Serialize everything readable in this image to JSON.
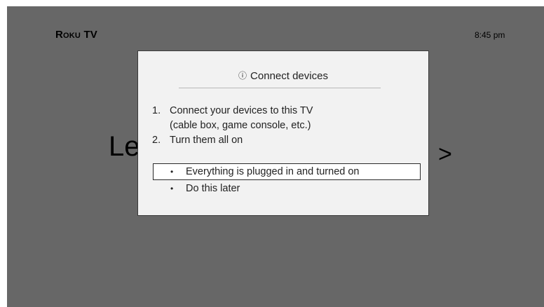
{
  "header": {
    "brand": "Roku TV",
    "time": "8:45 pm"
  },
  "background": {
    "left_text": "Le",
    "right_text": ">"
  },
  "dialog": {
    "title_icon": "ⓘ",
    "title": "Connect devices",
    "steps": [
      {
        "number": "1.",
        "line1": "Connect your devices to this TV",
        "line2": "(cable box, game console, etc.)"
      },
      {
        "number": "2.",
        "line1": "Turn them all on"
      }
    ],
    "options": [
      {
        "bullet": "•",
        "label": "Everything is plugged in and turned on",
        "selected": true
      },
      {
        "bullet": "•",
        "label": "Do this later",
        "selected": false
      }
    ]
  }
}
